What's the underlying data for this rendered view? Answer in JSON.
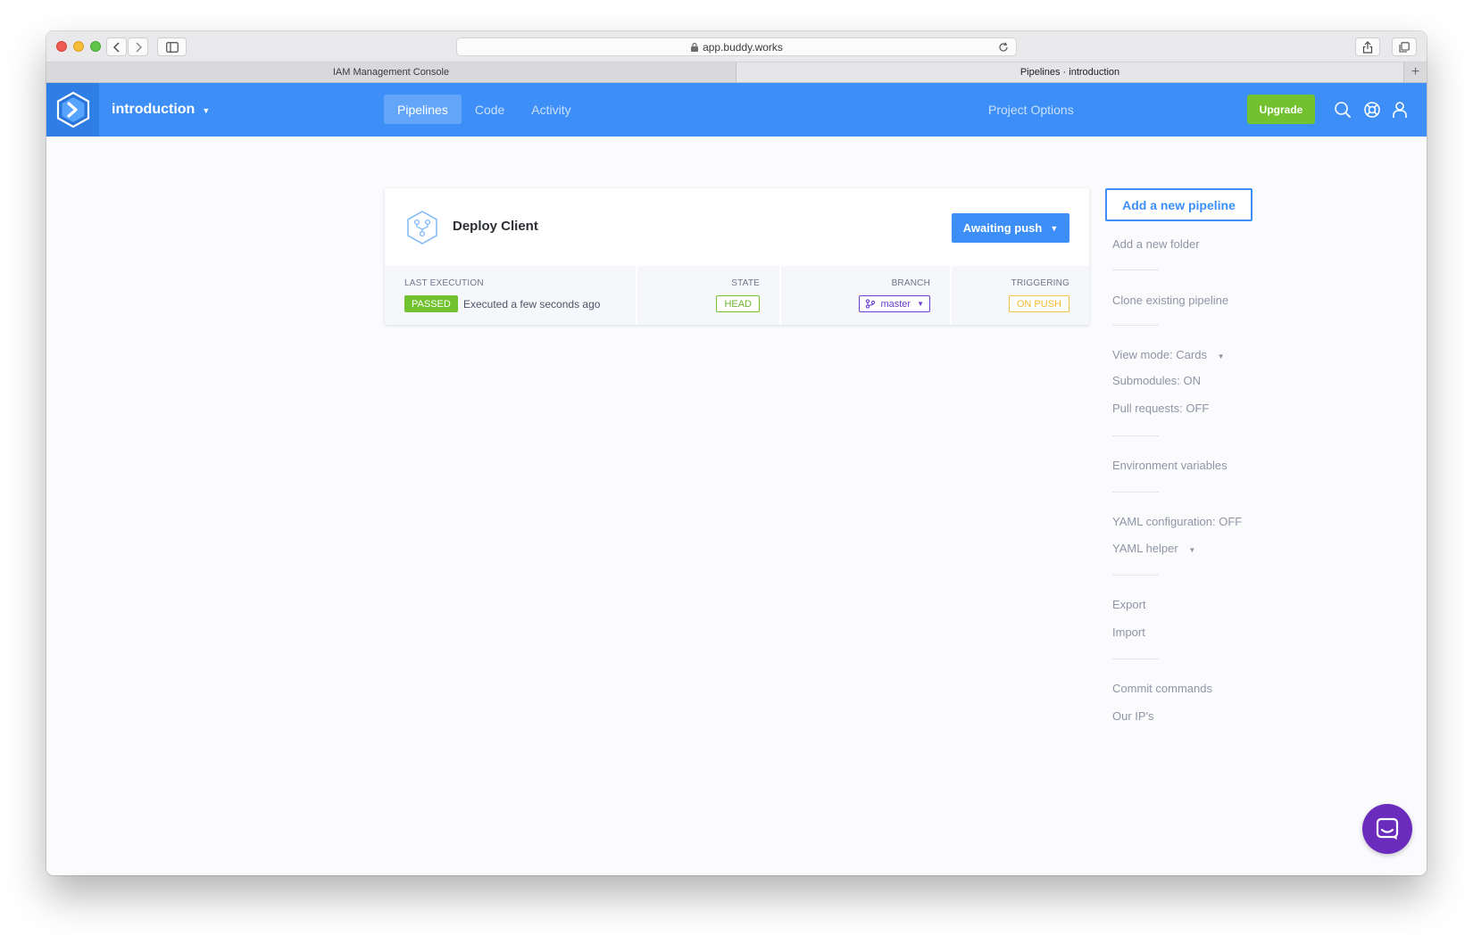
{
  "browser": {
    "url": "app.buddy.works",
    "tabs": [
      {
        "label": "IAM Management Console",
        "active": false
      },
      {
        "label": "Pipelines · introduction",
        "active": true
      }
    ]
  },
  "header": {
    "project_name": "introduction",
    "nav": [
      {
        "label": "Pipelines",
        "active": true
      },
      {
        "label": "Code",
        "active": false
      },
      {
        "label": "Activity",
        "active": false
      }
    ],
    "project_options": "Project Options",
    "upgrade": "Upgrade"
  },
  "pipeline": {
    "name": "Deploy Client",
    "action_label": "Awaiting push",
    "last_execution_label": "LAST EXECUTION",
    "status": "PASSED",
    "executed": "Executed a few seconds ago",
    "state_label": "STATE",
    "state": "HEAD",
    "branch_label": "BRANCH",
    "branch": "master",
    "triggering_label": "TRIGGERING",
    "triggering": "ON PUSH"
  },
  "sidebar": {
    "add_pipeline": "Add a new pipeline",
    "add_folder": "Add a new folder",
    "clone": "Clone existing pipeline",
    "view_mode": "View mode: Cards",
    "submodules": "Submodules: ON",
    "pull_requests": "Pull requests: OFF",
    "env_vars": "Environment variables",
    "yaml_config": "YAML configuration: OFF",
    "yaml_helper": "YAML helper",
    "export": "Export",
    "import": "Import",
    "commit_commands": "Commit commands",
    "our_ips": "Our IP's"
  },
  "colors": {
    "brand_blue": "#3d8ff7",
    "success_green": "#72c12e",
    "branch_purple": "#6a3fd1",
    "trigger_yellow": "#f4c24d",
    "chat_purple": "#6b2bbd"
  }
}
